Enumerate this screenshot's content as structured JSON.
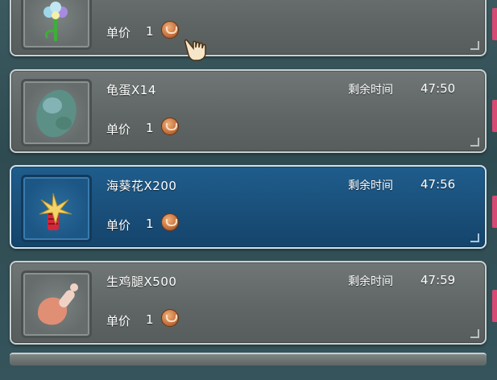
{
  "items": [
    {
      "name": "",
      "timer_label": "",
      "timer_value": "",
      "price_label": "单价",
      "price_value": "1",
      "icon": "flower-icon",
      "selected": false
    },
    {
      "name": "龟蛋X14",
      "timer_label": "剩余时间",
      "timer_value": "47:50",
      "price_label": "单价",
      "price_value": "1",
      "icon": "turtle-egg-icon",
      "selected": false
    },
    {
      "name": "海葵花X200",
      "timer_label": "剩余时间",
      "timer_value": "47:56",
      "price_label": "单价",
      "price_value": "1",
      "icon": "sea-anemone-flower-icon",
      "selected": true
    },
    {
      "name": "生鸡腿X500",
      "timer_label": "剩余时间",
      "timer_value": "47:59",
      "price_label": "单价",
      "price_value": "1",
      "icon": "raw-chicken-leg-icon",
      "selected": false
    }
  ],
  "colors": {
    "card_bg": "#6f7675",
    "selected_bg": "#1a4f7a",
    "accent_tab": "#d84a73",
    "coin": "#c4703d"
  }
}
